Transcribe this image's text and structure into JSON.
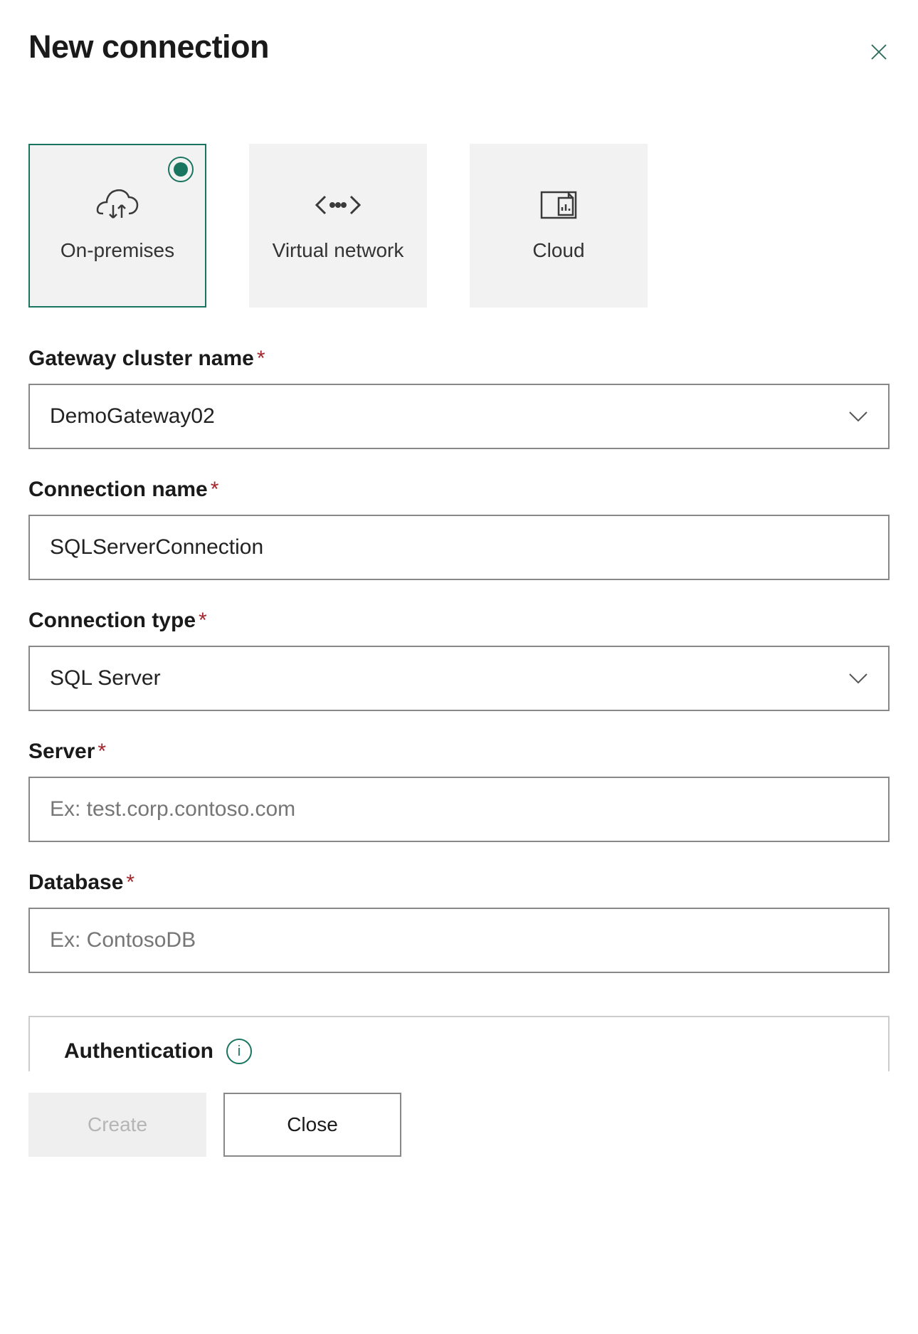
{
  "header": {
    "title": "New connection"
  },
  "types": {
    "on_premises": "On-premises",
    "virtual_network": "Virtual network",
    "cloud": "Cloud"
  },
  "fields": {
    "gateway_label": "Gateway cluster name",
    "gateway_value": "DemoGateway02",
    "connection_name_label": "Connection name",
    "connection_name_value": "SQLServerConnection",
    "connection_type_label": "Connection type",
    "connection_type_value": "SQL Server",
    "server_label": "Server",
    "server_placeholder": "Ex: test.corp.contoso.com",
    "server_value": "",
    "database_label": "Database",
    "database_placeholder": "Ex: ContosoDB",
    "database_value": "",
    "auth_label": "Authentication"
  },
  "footer": {
    "create_label": "Create",
    "close_label": "Close"
  }
}
